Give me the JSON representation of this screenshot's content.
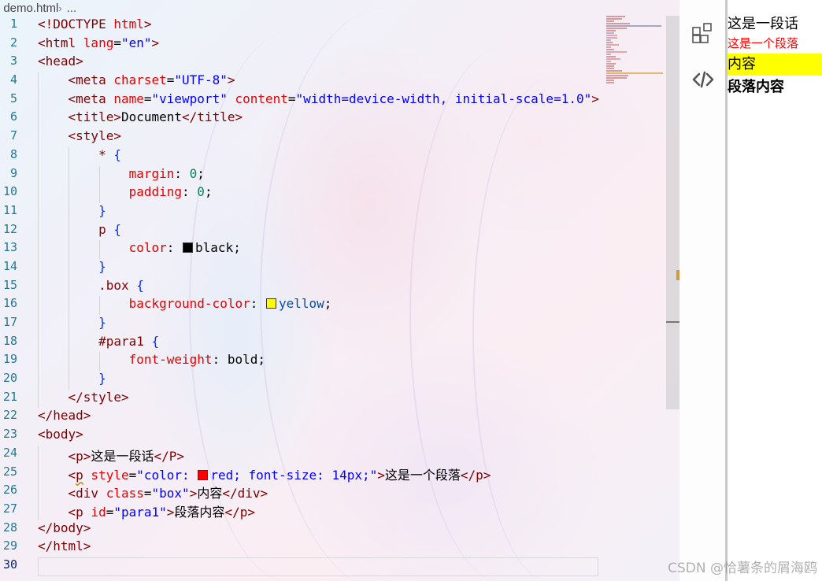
{
  "editor": {
    "breadcrumb": {
      "file_name": "demo.html",
      "ellipsis": "..."
    },
    "active_line": 30,
    "line_numbers": [
      "1",
      "2",
      "3",
      "4",
      "5",
      "6",
      "7",
      "8",
      "9",
      "10",
      "11",
      "12",
      "13",
      "14",
      "15",
      "16",
      "17",
      "18",
      "19",
      "20",
      "21",
      "22",
      "23",
      "24",
      "25",
      "26",
      "27",
      "28",
      "29",
      "30"
    ],
    "code": {
      "l1": {
        "a": "<!DOCTYPE ",
        "b": "html",
        "c": ">"
      },
      "l2": {
        "a": "<html ",
        "b": "lang",
        "c": "=",
        "d": "\"en\"",
        "e": ">"
      },
      "l3": {
        "a": "<head>"
      },
      "l4": {
        "a": "<meta ",
        "b": "charset",
        "c": "=",
        "d": "\"UTF-8\"",
        "e": ">"
      },
      "l5": {
        "a": "<meta ",
        "b": "name",
        "c": "=",
        "d": "\"viewport\"",
        "e": "content",
        "f": "=",
        "g": "\"width=device-width, initial-scale=1.0\"",
        "h": ">"
      },
      "l6": {
        "a": "<title>",
        "b": "Document",
        "c": "</title>"
      },
      "l7": {
        "a": "<style>"
      },
      "l8": {
        "a": "* ",
        "b": "{"
      },
      "l9": {
        "a": "margin",
        "b": ": ",
        "c": "0",
        "d": ";"
      },
      "l10": {
        "a": "padding",
        "b": ": ",
        "c": "0",
        "d": ";"
      },
      "l11": {
        "a": "}"
      },
      "l12": {
        "a": "p ",
        "b": "{"
      },
      "l13": {
        "a": "color",
        "b": ": ",
        "c": "black",
        "d": ";"
      },
      "l14": {
        "a": "}"
      },
      "l15": {
        "a": ".box ",
        "b": "{"
      },
      "l16": {
        "a": "background-color",
        "b": ": ",
        "c": "yellow",
        "d": ";"
      },
      "l17": {
        "a": "}"
      },
      "l18": {
        "a": "#para1 ",
        "b": "{"
      },
      "l19": {
        "a": "font-weight",
        "b": ": ",
        "c": "bold",
        "d": ";"
      },
      "l20": {
        "a": "}"
      },
      "l21": {
        "a": "</style>"
      },
      "l22": {
        "a": "</head>"
      },
      "l23": {
        "a": "<body>"
      },
      "l24": {
        "a": "<p>",
        "b": "这是一段话",
        "c": "</P>"
      },
      "l25": {
        "a": "<",
        "b": "p",
        "c": " style",
        "d": "=",
        "e": "\"color: ",
        "f": "red",
        "g": "; font-size: 14px;\"",
        "h": ">",
        "i": "这是一个段落",
        "j": "</p>"
      },
      "l26": {
        "a": "<div ",
        "b": "class",
        "c": "=",
        "d": "\"box\"",
        "e": ">",
        "f": "内容",
        "g": "</div>"
      },
      "l27": {
        "a": "<p ",
        "b": "id",
        "c": "=",
        "d": "\"para1\"",
        "e": ">",
        "f": "段落内容",
        "g": "</p>"
      },
      "l28": {
        "a": "</body>"
      },
      "l29": {
        "a": "</html>"
      }
    },
    "swatches": {
      "black": "#000000",
      "yellow": "#ffff00",
      "red": "#ff0000"
    }
  },
  "activity_bar": {
    "icons": [
      "extensions-icon",
      "live-preview-icon"
    ]
  },
  "preview": {
    "p1": "这是一段话",
    "p2": "这是一个段落",
    "box": "内容",
    "para1": "段落内容",
    "colors": {
      "red": "#ff0000",
      "box_bg": "#ffff00"
    }
  },
  "watermark": "CSDN @恰薯条的屑海鸥"
}
